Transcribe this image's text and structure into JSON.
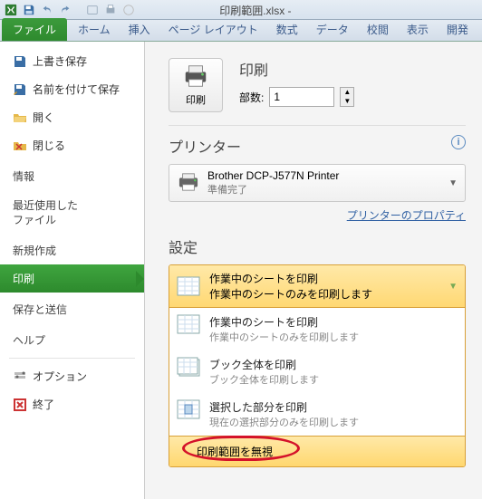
{
  "window": {
    "filename": "印刷範囲.xlsx -"
  },
  "ribbon": {
    "file": "ファイル",
    "tabs": [
      "ホーム",
      "挿入",
      "ページ レイアウト",
      "数式",
      "データ",
      "校閲",
      "表示",
      "開発"
    ]
  },
  "backstage_left": {
    "save": "上書き保存",
    "save_as": "名前を付けて保存",
    "open": "開く",
    "close": "閉じる",
    "info": "情報",
    "recent1": "最近使用した",
    "recent2": "ファイル",
    "new": "新規作成",
    "print": "印刷",
    "save_send": "保存と送信",
    "help": "ヘルプ",
    "options": "オプション",
    "exit": "終了"
  },
  "print_panel": {
    "title": "印刷",
    "copies_label": "部数:",
    "copies_value": "1",
    "print_button": "印刷",
    "printer_title": "プリンター",
    "printer_name": "Brother DCP-J577N Printer",
    "printer_status": "準備完了",
    "printer_props": "プリンターのプロパティ",
    "settings_title": "設定",
    "selected": {
      "t1": "作業中のシートを印刷",
      "t2": "作業中のシートのみを印刷します"
    },
    "opts": [
      {
        "t1": "作業中のシートを印刷",
        "t2": "作業中のシートのみを印刷します"
      },
      {
        "t1": "ブック全体を印刷",
        "t2": "ブック全体を印刷します"
      },
      {
        "t1": "選択した部分を印刷",
        "t2": "現在の選択部分のみを印刷します"
      }
    ],
    "ignore": "印刷範囲を無視"
  }
}
